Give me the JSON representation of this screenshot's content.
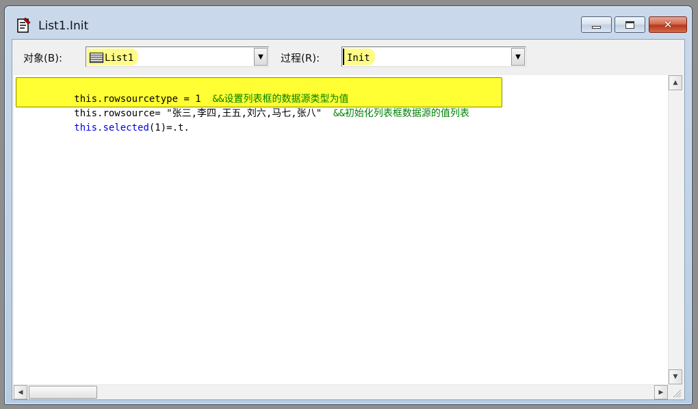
{
  "window": {
    "title": "List1.Init"
  },
  "toolbar": {
    "object_label": "对象(B):",
    "object_value": "List1",
    "procedure_label": "过程(R):",
    "procedure_value": "Init"
  },
  "code_lines": [
    {
      "code": "this.rowsourcetype = 1  ",
      "comment": "&&设置列表框的数据源类型为值"
    },
    {
      "code": "this.rowsource= \"张三,李四,王五,刘六,马七,张八\"  ",
      "comment": "&&初始化列表框数据源的值列表"
    },
    {
      "code": "this.selected",
      "rest": "(1)=.t."
    }
  ],
  "icons": {
    "title": "code-window-icon",
    "object": "list-object-icon",
    "dropdown": "chevron-down-icon"
  },
  "colors": {
    "highlight": "#ffff33",
    "keyword": "#0000e0",
    "comment": "#008000"
  }
}
